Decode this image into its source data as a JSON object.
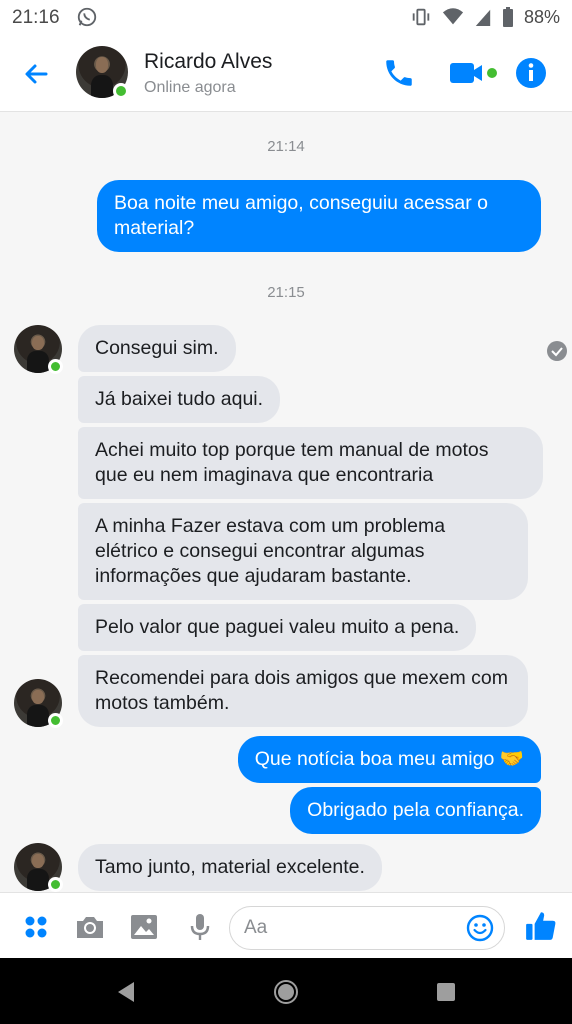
{
  "status_bar": {
    "time": "21:16",
    "battery": "88%"
  },
  "header": {
    "name": "Ricardo Alves",
    "status": "Online agora"
  },
  "messages": {
    "ts1": "21:14",
    "m1": "Boa noite meu amigo, conseguiu acessar o material?",
    "ts2": "21:15",
    "m2": "Consegui sim.",
    "m3": "Já baixei tudo aqui.",
    "m4": "Achei muito top porque tem manual de motos que eu nem imaginava que encontraria",
    "m5": "A minha Fazer estava com um problema elétrico e consegui encontrar algumas informações que ajudaram bastante.",
    "m6": "Pelo valor que paguei valeu muito a pena.",
    "m7": "Recomendei para dois amigos que mexem com motos também.",
    "m8": "Que notícia boa meu amigo 🤝",
    "m9": "Obrigado pela confiança.",
    "m10": "Tamo junto, material excelente."
  },
  "composer": {
    "placeholder": "Aa"
  },
  "colors": {
    "accent": "#0084ff",
    "online": "#44bd32",
    "incoming": "#e4e6eb"
  },
  "icons": [
    "back-arrow-icon",
    "phone-icon",
    "video-icon",
    "info-icon",
    "apps-icon",
    "camera-icon",
    "image-icon",
    "mic-icon",
    "emoji-icon",
    "like-icon"
  ]
}
